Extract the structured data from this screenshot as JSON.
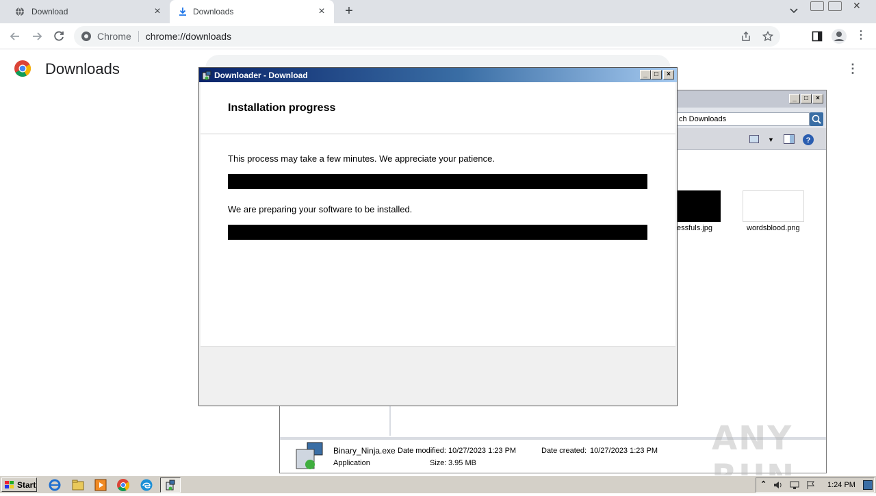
{
  "browser": {
    "tabs": [
      {
        "label": "Download",
        "icon": "globe-icon"
      },
      {
        "label": "Downloads",
        "icon": "download-icon"
      }
    ],
    "new_tab_label": "+",
    "omnibox": {
      "site": "Chrome",
      "url": "chrome://downloads"
    },
    "page_title": "Downloads"
  },
  "explorer": {
    "search_text": "ch Downloads",
    "files": [
      {
        "name": "essfuls.jpg"
      },
      {
        "name": "wordsblood.png"
      }
    ],
    "status": {
      "filename": "Binary_Ninja.exe",
      "type": "Application",
      "date_modified_label": "Date modified:",
      "date_modified": "10/27/2023 1:23 PM",
      "date_created_label": "Date created:",
      "date_created": "10/27/2023 1:23 PM",
      "size_label": "Size:",
      "size": "3.95 MB"
    }
  },
  "dialog": {
    "title": "Downloader - Download",
    "heading": "Installation progress",
    "message1": "This process may take a few minutes. We appreciate your patience.",
    "message2": "We are preparing your software to be installed."
  },
  "taskbar": {
    "start_label": "Start",
    "clock": "1:24 PM"
  },
  "watermark": "ANY RUN"
}
